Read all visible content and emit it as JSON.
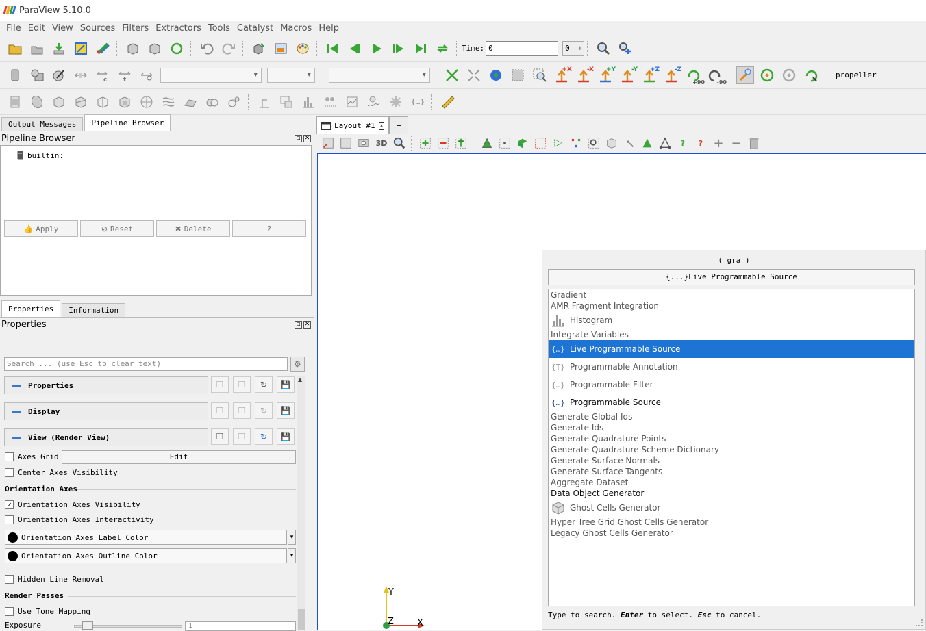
{
  "window": {
    "title": "ParaView 5.10.0",
    "logo_colors": [
      "#e23b2e",
      "#f2b01e",
      "#2e9e47",
      "#2f6fd6"
    ]
  },
  "menu": [
    "File",
    "Edit",
    "View",
    "Sources",
    "Filters",
    "Extractors",
    "Tools",
    "Catalyst",
    "Macros",
    "Help"
  ],
  "toolbar": {
    "time_label": "Time:",
    "time_value": "0",
    "time_index": "0",
    "camera_labels": [
      "+X",
      "-X",
      "+Y",
      "-Y",
      "+Z",
      "-Z"
    ],
    "rotate_labels": [
      "+90",
      "-90"
    ],
    "view_name": "propeller",
    "accent_colors": {
      "green": "#3aa635",
      "orange": "#e08a1e",
      "red": "#d83a2a",
      "blue": "#2f6fd6"
    }
  },
  "left_panel": {
    "tabs": [
      "Output Messages",
      "Pipeline Browser"
    ],
    "pipeline_title": "Pipeline Browser",
    "pipeline_item": "builtin:",
    "props_tabs": [
      "Properties",
      "Information"
    ],
    "props_title": "Properties",
    "buttons": {
      "apply": "Apply",
      "reset": "Reset",
      "delete": "Delete",
      "help": "?"
    },
    "search_placeholder": "Search ... (use Esc to clear text)",
    "sections": {
      "properties": "Properties",
      "display": "Display",
      "view": "View (Render View)"
    },
    "axes_grid": "Axes Grid",
    "edit": "Edit",
    "center_axes": "Center Axes Visibility",
    "orientation_header": "Orientation Axes",
    "orientation_visibility": "Orientation Axes Visibility",
    "orientation_visibility_checked": true,
    "orientation_interactivity": "Orientation Axes Interactivity",
    "label_color": "Orientation Axes Label Color",
    "outline_color": "Orientation Axes Outline Color",
    "hidden_line": "Hidden Line Removal",
    "render_passes": "Render Passes",
    "tone_mapping": "Use Tone Mapping",
    "exposure": "Exposure",
    "exposure_value": "1"
  },
  "layout": {
    "tab_label": "Layout #1",
    "plus": "+",
    "mode_3d": "3D"
  },
  "axes_widget": {
    "y": "Y",
    "z": "Z",
    "x": "X"
  },
  "popup": {
    "query": "( gra )",
    "selected_button": "{...}Live Programmable Source",
    "items": [
      {
        "label": "Gradient",
        "icon": ""
      },
      {
        "label": "AMR Fragment Integration",
        "icon": ""
      },
      {
        "label": "Histogram",
        "icon": "histogram-icon"
      },
      {
        "label": "Integrate Variables",
        "icon": ""
      },
      {
        "label": "Live Programmable Source",
        "icon": "braces-icon",
        "selected": true
      },
      {
        "label": "Programmable Annotation",
        "icon": "annotation-icon"
      },
      {
        "label": "Programmable Filter",
        "icon": "braces-icon"
      },
      {
        "label": "Programmable Source",
        "icon": "braces-icon"
      },
      {
        "label": "Generate Global Ids",
        "icon": ""
      },
      {
        "label": "Generate Ids",
        "icon": ""
      },
      {
        "label": "Generate Quadrature Points",
        "icon": ""
      },
      {
        "label": "Generate Quadrature Scheme Dictionary",
        "icon": ""
      },
      {
        "label": "Generate Surface Normals",
        "icon": ""
      },
      {
        "label": "Generate Surface Tangents",
        "icon": ""
      },
      {
        "label": "Aggregate Dataset",
        "icon": ""
      },
      {
        "label": "Data Object Generator",
        "icon": ""
      },
      {
        "label": "Ghost Cells Generator",
        "icon": "ghost-cells-icon"
      },
      {
        "label": "Hyper Tree Grid Ghost Cells Generator",
        "icon": ""
      },
      {
        "label": "Legacy Ghost Cells Generator",
        "icon": ""
      }
    ],
    "hint_parts": [
      "Type to search. ",
      "Enter",
      " to select. ",
      "Esc",
      " to cancel."
    ]
  }
}
